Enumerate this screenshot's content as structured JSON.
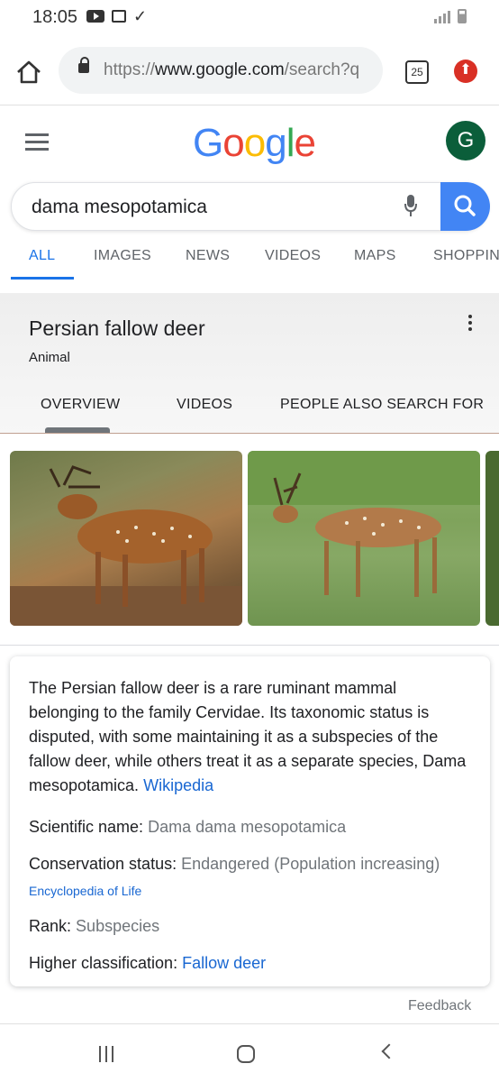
{
  "status_bar": {
    "time": "18:05",
    "icons": [
      "youtube-icon",
      "gallery-icon",
      "check-icon",
      "signal-icon",
      "battery-icon"
    ]
  },
  "browser": {
    "url_scheme": "https://",
    "url_host": "www.google.com",
    "url_path": "/search?q",
    "tab_count": "25",
    "icons": [
      "home-icon",
      "lock-icon",
      "update-icon"
    ]
  },
  "google": {
    "logo_letters": [
      {
        "ch": "G",
        "color": "#4285F4"
      },
      {
        "ch": "o",
        "color": "#EA4335"
      },
      {
        "ch": "o",
        "color": "#FBBC05"
      },
      {
        "ch": "g",
        "color": "#4285F4"
      },
      {
        "ch": "l",
        "color": "#34A853"
      },
      {
        "ch": "e",
        "color": "#EA4335"
      }
    ],
    "avatar_letter": "G"
  },
  "search": {
    "query": "dama mesopotamica"
  },
  "result_tabs": [
    "ALL",
    "IMAGES",
    "NEWS",
    "VIDEOS",
    "MAPS",
    "SHOPPING"
  ],
  "active_tab": "ALL",
  "knowledge_panel": {
    "title": "Persian fallow deer",
    "subtitle": "Animal",
    "tabs": [
      "OVERVIEW",
      "VIDEOS",
      "PEOPLE ALSO SEARCH FOR"
    ]
  },
  "description": {
    "text": "The Persian fallow deer is a rare ruminant mammal belonging to the family Cervidae. Its taxonomic status is disputed, with some maintaining it as a subspecies of the fallow deer, while others treat it as a separate species, Dama mesopotamica.",
    "source": "Wikipedia"
  },
  "facts": {
    "scientific_label": "Scientific name:",
    "scientific_value": "Dama dama mesopotamica",
    "conservation_label": "Conservation status:",
    "conservation_value": "Endangered (Population increasing)",
    "conservation_source": "Encyclopedia of Life",
    "rank_label": "Rank:",
    "rank_value": "Subspecies",
    "higher_label": "Higher classification:",
    "higher_value": "Fallow deer"
  },
  "feedback": "Feedback",
  "colors": {
    "accent": "#1a73e8",
    "link": "#1967d2",
    "avatar": "#0b5e3a"
  }
}
